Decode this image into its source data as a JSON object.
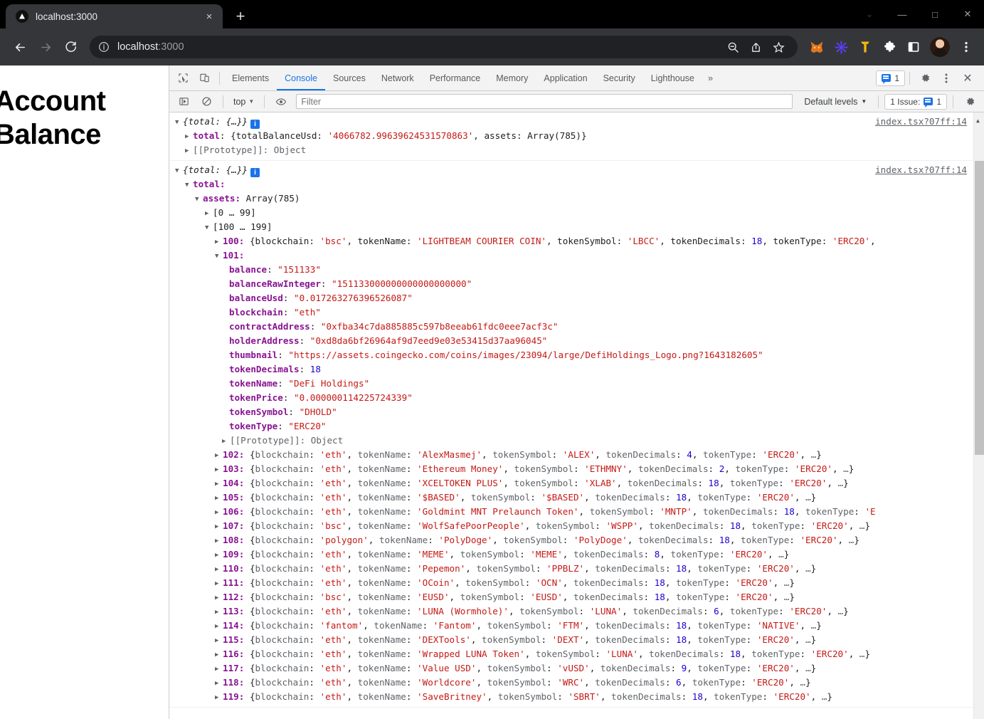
{
  "browser": {
    "tab": {
      "title": "localhost:3000",
      "close_label": "×",
      "favicon": "nextjs-triangle-icon"
    },
    "new_tab_label": "+",
    "window_controls": {
      "restore_down": "⌄",
      "minimize": "—",
      "maximize": "□",
      "close": "✕"
    },
    "omnibox": {
      "value_host": "localhost",
      "value_path": ":3000",
      "info_icon": "info-circle-icon"
    },
    "actions": [
      "zoom-out-icon",
      "share-icon",
      "bookmark-star-icon"
    ],
    "extensions": [
      "metamask-fox-icon",
      "purple-flower-extension-icon",
      "gold-t-extension-icon",
      "puzzle-extensions-icon",
      "side-panel-icon"
    ],
    "profile": "user-avatar",
    "menu": "kebab-menu-icon"
  },
  "page": {
    "heading": "Account Balance"
  },
  "devtools": {
    "tabs": [
      {
        "label": "Elements",
        "active": false
      },
      {
        "label": "Console",
        "active": true
      },
      {
        "label": "Sources",
        "active": false
      },
      {
        "label": "Network",
        "active": false
      },
      {
        "label": "Performance",
        "active": false
      },
      {
        "label": "Memory",
        "active": false
      },
      {
        "label": "Application",
        "active": false
      },
      {
        "label": "Security",
        "active": false
      },
      {
        "label": "Lighthouse",
        "active": false
      }
    ],
    "more_tabs_label": "»",
    "issues_count": "1",
    "settings_label": "gear-icon",
    "more_options_label": "kebab-icon",
    "close_label": "✕",
    "toolbar": {
      "inspect_icon": "inspect-element-icon",
      "device_toolbar_icon": "device-toolbar-icon",
      "sidebar_toggle_icon": "console-sidebar-icon",
      "clear_console_icon": "clear-console-icon",
      "context_value": "top",
      "context_caret": "▼",
      "eye_icon": "live-expression-eye-icon",
      "filter_placeholder": "Filter",
      "filter_value": "",
      "levels_label": "Default levels",
      "levels_caret": "▼",
      "issue_label": "1 Issue:",
      "issue_count": "1",
      "console_settings_icon": "gear-icon"
    }
  },
  "console": {
    "source_link": "index.tsx?07ff:14",
    "entry1": {
      "header": "{total: {…}}",
      "total_line": {
        "key": "total",
        "prefix": "{totalBalanceUsd: ",
        "value": "'4066782.99639624531570863'",
        "suffix": ", assets: Array(785)}"
      },
      "proto": "[[Prototype]]: Object"
    },
    "entry2": {
      "header": "{total: {…}}",
      "total_key": "total:",
      "assets_key": "assets:",
      "assets_value": "Array(785)",
      "range_collapsed": "[0 … 99]",
      "range_expanded": "[100 … 199]",
      "item100": {
        "index": "100:",
        "text": "{blockchain: 'bsc', tokenName: 'LIGHTBEAM COURIER COIN', tokenSymbol: 'LBCC', tokenDecimals: 18, tokenType: 'ERC20',"
      },
      "item101_index": "101:",
      "item101_props": [
        {
          "key": "balance",
          "value": "\"151133\"",
          "type": "string"
        },
        {
          "key": "balanceRawInteger",
          "value": "\"151133000000000000000000\"",
          "type": "string"
        },
        {
          "key": "balanceUsd",
          "value": "\"0.017263276396526087\"",
          "type": "string"
        },
        {
          "key": "blockchain",
          "value": "\"eth\"",
          "type": "string"
        },
        {
          "key": "contractAddress",
          "value": "\"0xfba34c7da885885c597b8eeab61fdc0eee7acf3c\"",
          "type": "string"
        },
        {
          "key": "holderAddress",
          "value": "\"0xd8da6bf26964af9d7eed9e03e53415d37aa96045\"",
          "type": "string"
        },
        {
          "key": "thumbnail",
          "value": "\"https://assets.coingecko.com/coins/images/23094/large/DefiHoldings_Logo.png?1643182605\"",
          "type": "string"
        },
        {
          "key": "tokenDecimals",
          "value": "18",
          "type": "number"
        },
        {
          "key": "tokenName",
          "value": "\"DeFi Holdings\"",
          "type": "string"
        },
        {
          "key": "tokenPrice",
          "value": "\"0.000000114225724339\"",
          "type": "string"
        },
        {
          "key": "tokenSymbol",
          "value": "\"DHOLD\"",
          "type": "string"
        },
        {
          "key": "tokenType",
          "value": "\"ERC20\"",
          "type": "string"
        }
      ],
      "item101_proto": "[[Prototype]]: Object",
      "collapsed_items": [
        {
          "index": "102:",
          "blockchain": "eth",
          "tokenName": "AlexMasmej",
          "tokenSymbol": "ALEX",
          "tokenDecimals": "4",
          "tokenType": "ERC20",
          "truncated": false
        },
        {
          "index": "103:",
          "blockchain": "eth",
          "tokenName": "Ethereum Money",
          "tokenSymbol": "ETHMNY",
          "tokenDecimals": "2",
          "tokenType": "ERC20",
          "truncated": false
        },
        {
          "index": "104:",
          "blockchain": "eth",
          "tokenName": "XCELTOKEN PLUS",
          "tokenSymbol": "XLAB",
          "tokenDecimals": "18",
          "tokenType": "ERC20",
          "truncated": false
        },
        {
          "index": "105:",
          "blockchain": "eth",
          "tokenName": "$BASED",
          "tokenSymbol": "$BASED",
          "tokenDecimals": "18",
          "tokenType": "ERC20",
          "truncated": false
        },
        {
          "index": "106:",
          "blockchain": "eth",
          "tokenName": "Goldmint MNT Prelaunch Token",
          "tokenSymbol": "MNTP",
          "tokenDecimals": "18",
          "tokenType": "E",
          "truncated": true
        },
        {
          "index": "107:",
          "blockchain": "bsc",
          "tokenName": "WolfSafePoorPeople",
          "tokenSymbol": "WSPP",
          "tokenDecimals": "18",
          "tokenType": "ERC20",
          "truncated": false
        },
        {
          "index": "108:",
          "blockchain": "polygon",
          "tokenName": "PolyDoge",
          "tokenSymbol": "PolyDoge",
          "tokenDecimals": "18",
          "tokenType": "ERC20",
          "truncated": false
        },
        {
          "index": "109:",
          "blockchain": "eth",
          "tokenName": "MEME",
          "tokenSymbol": "MEME",
          "tokenDecimals": "8",
          "tokenType": "ERC20",
          "truncated": false
        },
        {
          "index": "110:",
          "blockchain": "eth",
          "tokenName": "Pepemon",
          "tokenSymbol": "PPBLZ",
          "tokenDecimals": "18",
          "tokenType": "ERC20",
          "truncated": false
        },
        {
          "index": "111:",
          "blockchain": "eth",
          "tokenName": "OCoin",
          "tokenSymbol": "OCN",
          "tokenDecimals": "18",
          "tokenType": "ERC20",
          "truncated": false
        },
        {
          "index": "112:",
          "blockchain": "bsc",
          "tokenName": "EUSD",
          "tokenSymbol": "EUSD",
          "tokenDecimals": "18",
          "tokenType": "ERC20",
          "truncated": false
        },
        {
          "index": "113:",
          "blockchain": "eth",
          "tokenName": "LUNA (Wormhole)",
          "tokenSymbol": "LUNA",
          "tokenDecimals": "6",
          "tokenType": "ERC20",
          "truncated": false
        },
        {
          "index": "114:",
          "blockchain": "fantom",
          "tokenName": "Fantom",
          "tokenSymbol": "FTM",
          "tokenDecimals": "18",
          "tokenType": "NATIVE",
          "truncated": false
        },
        {
          "index": "115:",
          "blockchain": "eth",
          "tokenName": "DEXTools",
          "tokenSymbol": "DEXT",
          "tokenDecimals": "18",
          "tokenType": "ERC20",
          "truncated": false
        },
        {
          "index": "116:",
          "blockchain": "eth",
          "tokenName": "Wrapped LUNA Token",
          "tokenSymbol": "LUNA",
          "tokenDecimals": "18",
          "tokenType": "ERC20",
          "truncated": false
        },
        {
          "index": "117:",
          "blockchain": "eth",
          "tokenName": "Value USD",
          "tokenSymbol": "vUSD",
          "tokenDecimals": "9",
          "tokenType": "ERC20",
          "truncated": false
        },
        {
          "index": "118:",
          "blockchain": "eth",
          "tokenName": "Worldcore",
          "tokenSymbol": "WRC",
          "tokenDecimals": "6",
          "tokenType": "ERC20",
          "truncated": false
        },
        {
          "index": "119:",
          "blockchain": "eth",
          "tokenName": "SaveBritney",
          "tokenSymbol": "SBRT",
          "tokenDecimals": "18",
          "tokenType": "ERC20",
          "truncated": false
        }
      ]
    }
  },
  "colors": {
    "accent": "#1a73e8",
    "string": "#c41a16",
    "number": "#1c00cf",
    "property": "#881391"
  }
}
